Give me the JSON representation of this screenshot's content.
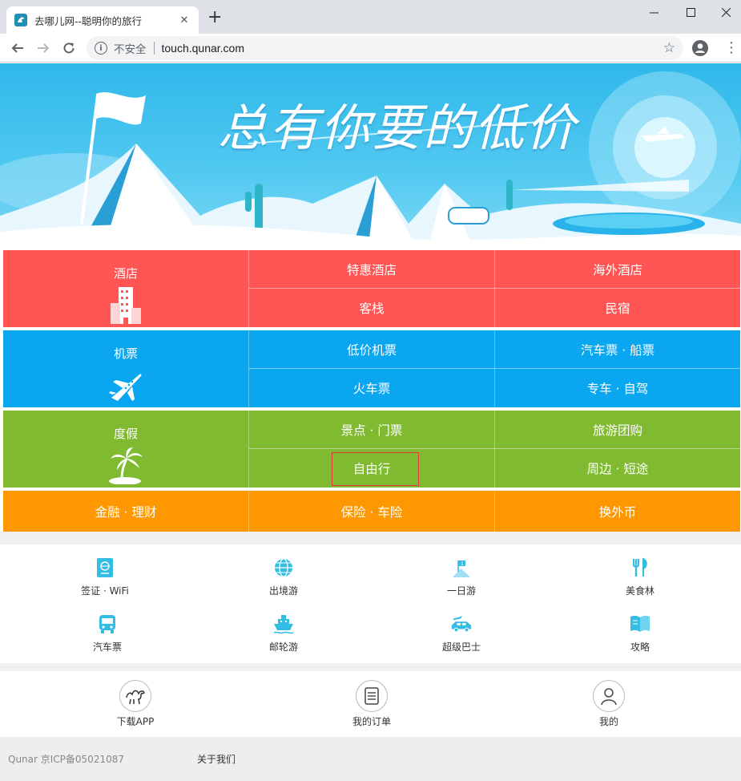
{
  "browser": {
    "tab_title": "去哪儿网--聪明你的旅行",
    "close_glyph": "✕",
    "new_tab_glyph": "+",
    "security_label": "不安全",
    "url": "touch.qunar.com",
    "minimize": "—",
    "maximize": "☐",
    "close_window": "✕"
  },
  "banner": {
    "slogan": "总有你要的低价"
  },
  "categories": {
    "hotel": {
      "main": "酒店",
      "items": [
        "特惠酒店",
        "海外酒店",
        "客栈",
        "民宿"
      ],
      "color": "#ff5555"
    },
    "flight": {
      "main": "机票",
      "items": [
        "低价机票",
        "汽车票 · 船票",
        "火车票",
        "专车 · 自驾"
      ],
      "color": "#0aa6f0"
    },
    "vacation": {
      "main": "度假",
      "items": [
        "景点 · 门票",
        "旅游团购",
        "自由行",
        "周边 · 短途"
      ],
      "color": "#7fba30"
    },
    "finance": {
      "items": [
        "金融 · 理财",
        "保险 · 车险",
        "换外币"
      ],
      "color": "#ff9800"
    }
  },
  "services": [
    {
      "label": "签证 · WiFi",
      "icon": "visa-icon"
    },
    {
      "label": "出境游",
      "icon": "globe-icon"
    },
    {
      "label": "一日游",
      "icon": "flag-icon"
    },
    {
      "label": "美食林",
      "icon": "fork-knife-icon"
    },
    {
      "label": "汽车票",
      "icon": "bus-icon"
    },
    {
      "label": "邮轮游",
      "icon": "ship-icon"
    },
    {
      "label": "超级巴士",
      "icon": "car-icon"
    },
    {
      "label": "攻略",
      "icon": "book-icon"
    }
  ],
  "bottom_nav": [
    {
      "label": "下载APP",
      "icon": "camel-icon"
    },
    {
      "label": "我的订单",
      "icon": "order-icon"
    },
    {
      "label": "我的",
      "icon": "user-icon"
    }
  ],
  "footer": {
    "icp": "Qunar 京ICP备05021087",
    "about": "关于我们"
  },
  "colors": {
    "accent_icon": "#34bde3",
    "selection_border": "#e23a3a"
  }
}
